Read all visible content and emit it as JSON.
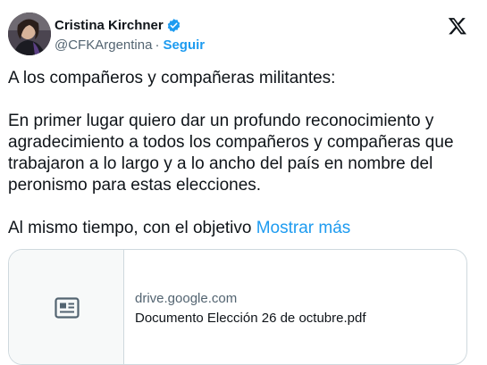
{
  "author": {
    "name": "Cristina Kirchner",
    "handle": "@CFKArgentina",
    "separator": "·",
    "follow_label": "Seguir",
    "avatar_icon": "profile-photo",
    "verified_icon": "verified-badge-icon"
  },
  "platform": {
    "logo_icon": "x-logo-icon"
  },
  "post": {
    "paragraphs": [
      "A los compañeros y compañeras militantes:",
      "En primer lugar quiero dar un profundo reconocimiento y agradecimiento a todos los compañeros y compañeras que trabajaron a lo largo y a lo ancho del país en nombre del peronismo para estas elecciones."
    ],
    "truncated_text": "Al mismo tiempo, con el objetivo",
    "show_more_label": "Mostrar más"
  },
  "link_card": {
    "domain": "drive.google.com",
    "title": "Documento Elección 26 de octubre.pdf",
    "thumb_icon": "document-icon"
  },
  "colors": {
    "accent": "#1d9bf0",
    "text": "#0f1419",
    "secondary": "#536471",
    "border": "#cfd9de"
  }
}
